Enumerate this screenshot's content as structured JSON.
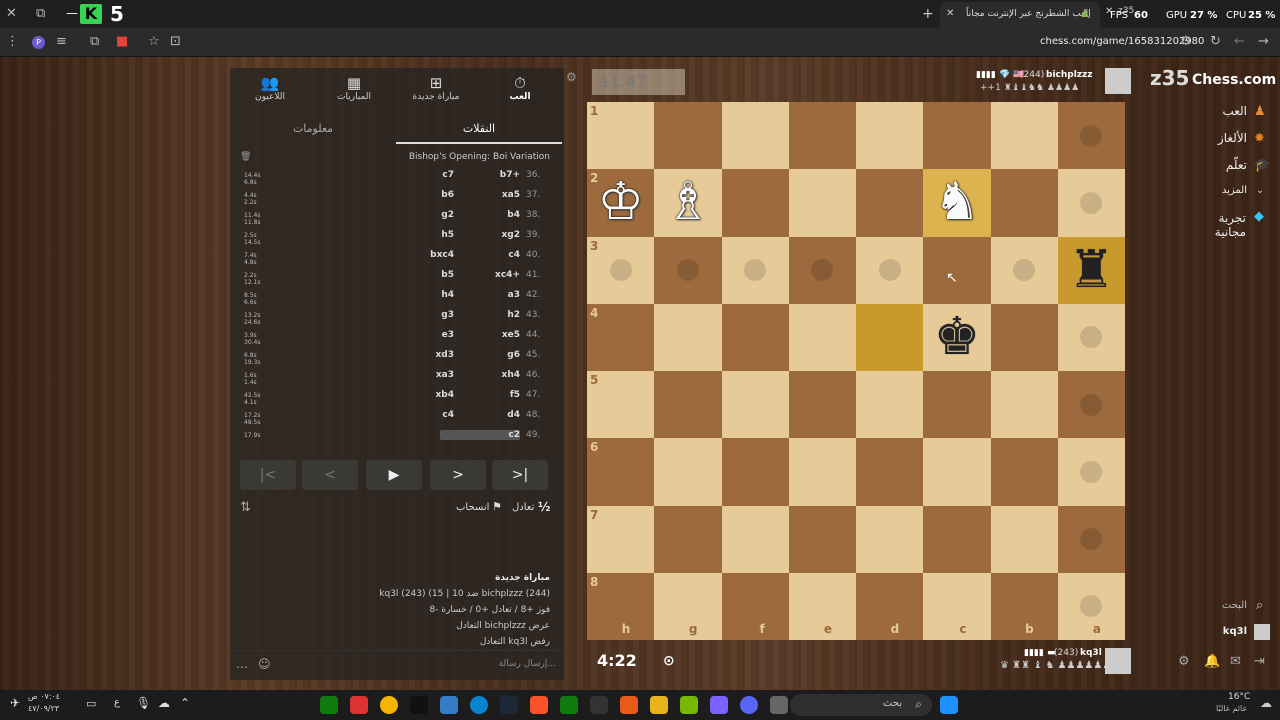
{
  "browser": {
    "overlay_number": "5",
    "fps_label": "FPS",
    "fps_value": "60",
    "gpu_label": "GPU",
    "gpu_value": "27 %",
    "cpu_label": "CPU",
    "cpu_value": "25 %",
    "tab1_title": "إلعب الشطرنج عبر الإنترنت مجاناً",
    "tab2_title": "z35",
    "url": "chess.com/game/165831202980"
  },
  "nav": {
    "play": "العب",
    "new_game": "مباراة جديدة",
    "games": "المباريات",
    "players": "اللاعبون"
  },
  "tabs": {
    "moves": "النقلات",
    "info": "معلومات"
  },
  "opening": "Bishop's Opening: Boi Variation",
  "moves": [
    {
      "n": "36.",
      "w": "b7+",
      "b": "c7"
    },
    {
      "n": "37.",
      "w": "xa5",
      "b": "b6"
    },
    {
      "n": "38.",
      "w": "b4",
      "b": "g2"
    },
    {
      "n": "39.",
      "w": "xg2",
      "b": "h5"
    },
    {
      "n": "40.",
      "w": "c4",
      "b": "bxc4"
    },
    {
      "n": "41.",
      "w": "xc4+",
      "b": "b5"
    },
    {
      "n": "42.",
      "w": "a3",
      "b": "h4"
    },
    {
      "n": "43.",
      "w": "h2",
      "b": "g3"
    },
    {
      "n": "44.",
      "w": "xe5",
      "b": "e3"
    },
    {
      "n": "45.",
      "w": "g6",
      "b": "xd3"
    },
    {
      "n": "46.",
      "w": "xh4",
      "b": "xa3"
    },
    {
      "n": "47.",
      "w": "f5",
      "b": "xb4"
    },
    {
      "n": "48.",
      "w": "d4",
      "b": "c4"
    },
    {
      "n": "49.",
      "w": "c2",
      "b": ""
    }
  ],
  "times": [
    [
      "14.4s",
      "6.8s"
    ],
    [
      "4.4s",
      "2.2s"
    ],
    [
      "11.4s",
      "11.8s"
    ],
    [
      "2.5s",
      "14.5s"
    ],
    [
      "7.4s",
      "4.8s"
    ],
    [
      "2.2s",
      "12.1s"
    ],
    [
      "8.5s",
      "6.6s"
    ],
    [
      "13.2s",
      "24.6s"
    ],
    [
      "3.9s",
      "30.4s"
    ],
    [
      "6.8s",
      "19.3s"
    ],
    [
      "1.6s",
      "1.4s"
    ],
    [
      "42.5s",
      "4.1s"
    ],
    [
      "17.2s",
      "48.5s"
    ],
    [
      "17.9s",
      ""
    ]
  ],
  "actions": {
    "draw": "تعادل",
    "half": "½",
    "resign": "انسحاب"
  },
  "game_info": {
    "title": "مباراة جديدة",
    "line1": "(244) bichplzzz ضد 10 | 15) (243) kq3l",
    "line2": "فوز +8 / تعادل +0 / خسارة -8",
    "line3": "عرض bichplzzz التعادل",
    "line4": "رفض kq3l التعادل"
  },
  "chat_placeholder": "إرسال رسالة...",
  "clock_top": "11:47",
  "clock_bottom": "4:22",
  "player_top": {
    "name": "bichplzzz",
    "rating": "(244)",
    "extra": "+1"
  },
  "player_bottom": {
    "name": "kq3l",
    "rating": "(243)"
  },
  "board": {
    "ranks": [
      "1",
      "2",
      "3",
      "4",
      "5",
      "6",
      "7",
      "8"
    ],
    "files": [
      "h",
      "g",
      "f",
      "e",
      "d",
      "c",
      "b",
      "a"
    ]
  },
  "brand": {
    "logo": "Chess.com",
    "overlay": "z35"
  },
  "sidebar": {
    "play": "العب",
    "puzzles": "الألغاز",
    "learn": "تعلّم",
    "more": "المزيد",
    "trial": "تجربة مجانية",
    "search": "البحث",
    "user": "kq3l"
  },
  "taskbar": {
    "search": "بحث",
    "time": "٠٧:٠٤ ص",
    "date": "٤٧/٠٩/٢٣",
    "lang": "ع",
    "temp": "16°C",
    "weather": "غائم غالبًا"
  },
  "colors": {
    "light": "#e6ca98",
    "dark": "#9c6a3d",
    "highlight": "#c89a2e",
    "green": "#81b64c"
  }
}
